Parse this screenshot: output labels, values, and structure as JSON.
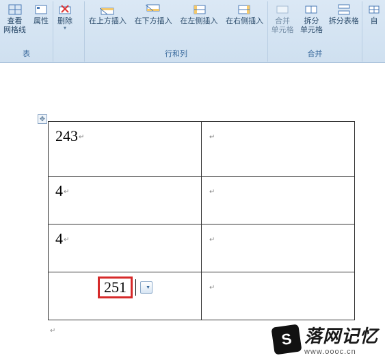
{
  "ribbon": {
    "groups": [
      {
        "label": "表",
        "buttons": [
          {
            "label": "查看\n网格线",
            "icon": "grid"
          },
          {
            "label": "属性",
            "icon": "props"
          }
        ]
      },
      {
        "label": "",
        "buttons": [
          {
            "label": "删除",
            "icon": "delete",
            "dropdown": true
          }
        ]
      },
      {
        "label": "行和列",
        "launcher": true,
        "buttons": [
          {
            "label": "在上方插入",
            "icon": "ins-above"
          },
          {
            "label": "在下方插入",
            "icon": "ins-below"
          },
          {
            "label": "在左侧插入",
            "icon": "ins-left"
          },
          {
            "label": "在右侧插入",
            "icon": "ins-right"
          }
        ]
      },
      {
        "label": "合并",
        "buttons": [
          {
            "label": "合并\n单元格",
            "icon": "merge",
            "disabled": true
          },
          {
            "label": "拆分\n单元格",
            "icon": "split"
          },
          {
            "label": "拆分表格",
            "icon": "split-table"
          }
        ]
      },
      {
        "label": "",
        "buttons": [
          {
            "label": "自",
            "icon": "auto"
          }
        ]
      }
    ]
  },
  "table": {
    "rows": [
      [
        "243",
        ""
      ],
      [
        "4",
        ""
      ],
      [
        "4",
        ""
      ],
      [
        "",
        ""
      ]
    ],
    "formula_value": "251"
  },
  "watermark": {
    "title": "落网记忆",
    "url": "www.oooc.cn",
    "logo_char": "S"
  }
}
